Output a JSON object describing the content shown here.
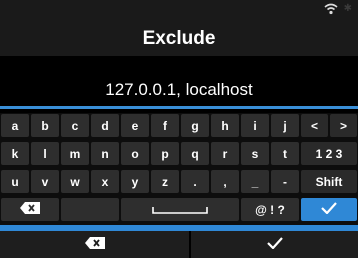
{
  "header": {
    "title": "Exclude"
  },
  "field": {
    "value": "127.0.0.1, localhost"
  },
  "keyboard": {
    "row1": [
      "a",
      "b",
      "c",
      "d",
      "e",
      "f",
      "g",
      "h",
      "i",
      "j",
      "<",
      ">"
    ],
    "row2": [
      "k",
      "l",
      "m",
      "n",
      "o",
      "p",
      "q",
      "r",
      "s",
      "t",
      "1 2 3"
    ],
    "row3": [
      "u",
      "v",
      "w",
      "x",
      "y",
      "z",
      ".",
      ",",
      "_",
      "-",
      "Shift"
    ],
    "row4": {
      "symbols_label": "@ ! ?"
    }
  },
  "colors": {
    "accent": "#2f88d6",
    "key": "#2e2e2e",
    "background": "#000000"
  },
  "icons": {
    "wifi": "wifi-icon",
    "backspace": "backspace-icon",
    "space": "spacebar-icon",
    "confirm": "checkmark-icon"
  }
}
